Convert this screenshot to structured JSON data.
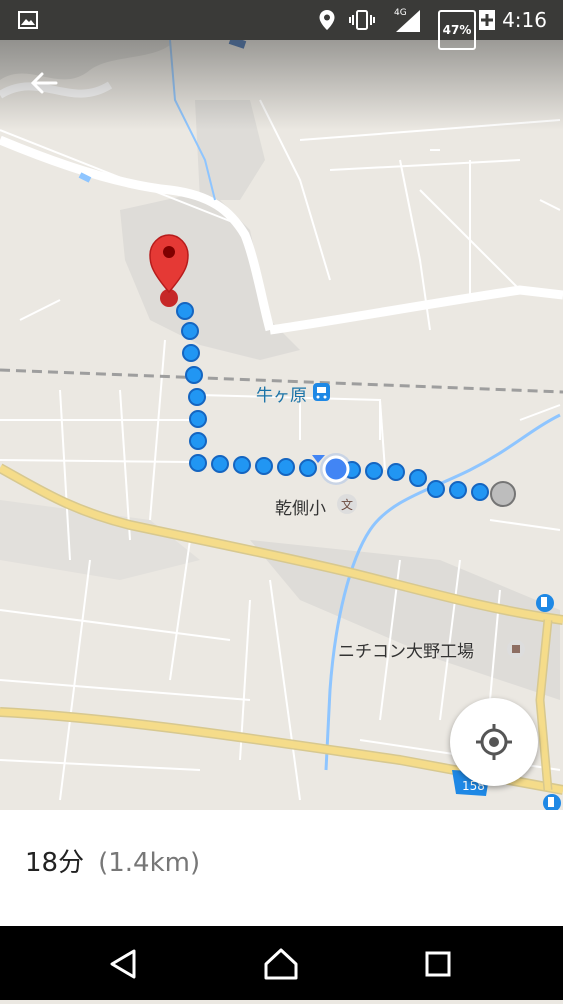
{
  "status_bar": {
    "time": "4:16",
    "battery": "47%",
    "network": "4G",
    "icons": [
      "image-icon",
      "location-icon",
      "vibrate-icon",
      "signal-icon",
      "battery-icon",
      "charging-plus-icon"
    ]
  },
  "map": {
    "labels": {
      "station": "牛ヶ原",
      "school": "乾側小",
      "school_icon": "文",
      "factory": "ニチコン大野工場",
      "route_number": "158"
    },
    "colors": {
      "route_dot": "#2196f3",
      "route_dot_border": "#1565c0",
      "pin": "#e53935",
      "current_location": "#4285f4",
      "major_road": "#f5dc8a",
      "water": "#8ec5ff"
    }
  },
  "route_info": {
    "duration": "18分",
    "distance": "(1.4km)"
  },
  "nav_bar": {
    "back": "back-icon",
    "home": "home-icon",
    "recents": "recents-icon"
  }
}
